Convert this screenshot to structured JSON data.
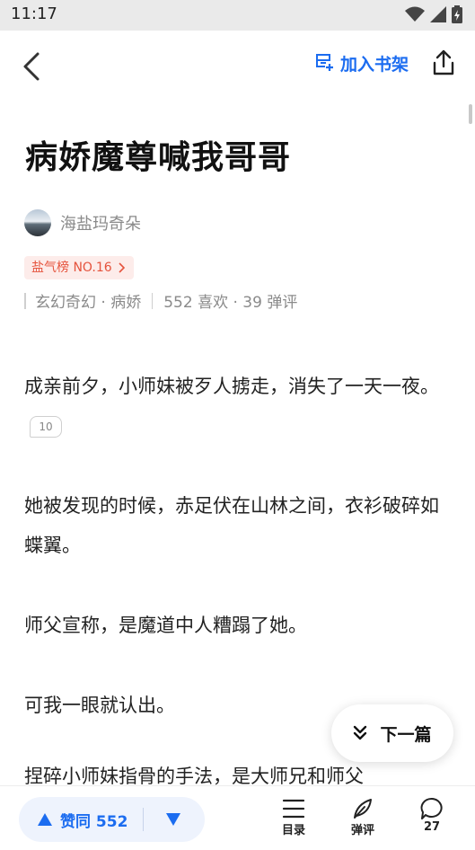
{
  "status": {
    "time": "11:17"
  },
  "nav": {
    "shelf_label": "加入书架"
  },
  "book": {
    "title": "病娇魔尊喊我哥哥",
    "author": "海盐玛奇朵",
    "rank_badge": "盐气榜 NO.16",
    "tags": "玄幻奇幻 · 病娇",
    "stats": "552 喜欢 · 39 弹评"
  },
  "content": {
    "paragraphs": [
      {
        "text": "成亲前夕，小师妹被歹人掳走，消失了一天一夜。",
        "comments": "10"
      },
      {
        "text": "她被发现的时候，赤足伏在山林之间，衣衫破碎如蝶翼。"
      },
      {
        "text": "师父宣称，是魔道中人糟蹋了她。"
      },
      {
        "text": "可我一眼就认出。"
      }
    ],
    "cut_paragraph": "捏碎小师妹指骨的手法，是大师兄和师父"
  },
  "next_button": {
    "label": "下一篇"
  },
  "bottom": {
    "like_label": "赞同 552",
    "toc_label": "目录",
    "danmaku_label": "弹评",
    "comment_count": "27"
  },
  "colors": {
    "accent": "#1b6cf0",
    "badge_red": "#e5533d"
  }
}
